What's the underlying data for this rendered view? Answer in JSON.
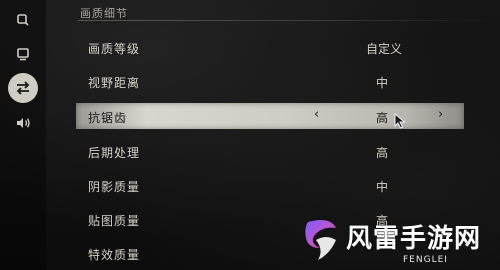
{
  "sidebar": {
    "items": [
      {
        "icon": "zoom-icon",
        "active": false
      },
      {
        "icon": "display-icon",
        "active": false
      },
      {
        "icon": "swap-arrows-icon",
        "active": true
      },
      {
        "icon": "volume-icon",
        "active": false
      }
    ]
  },
  "section": {
    "title": "画质细节"
  },
  "settings": [
    {
      "label": "画质等级",
      "value": "自定义",
      "selected": false
    },
    {
      "label": "视野距离",
      "value": "中",
      "selected": false
    },
    {
      "label": "抗锯齿",
      "value": "高",
      "selected": true,
      "prev_arrow": "‹",
      "next_arrow": "›"
    },
    {
      "label": "后期处理",
      "value": "高",
      "selected": false
    },
    {
      "label": "阴影质量",
      "value": "中",
      "selected": false
    },
    {
      "label": "贴图质量",
      "value": "高",
      "selected": false
    },
    {
      "label": "特效质量",
      "value": "",
      "selected": false
    }
  ],
  "watermark": {
    "title": "风雷手游网",
    "subtitle": "FENGLEI"
  },
  "colors": {
    "highlight": "#d9d6cf",
    "active_icon_bg": "#cfccc4",
    "text": "#d6d2c8",
    "background": "#0f0f0f"
  }
}
